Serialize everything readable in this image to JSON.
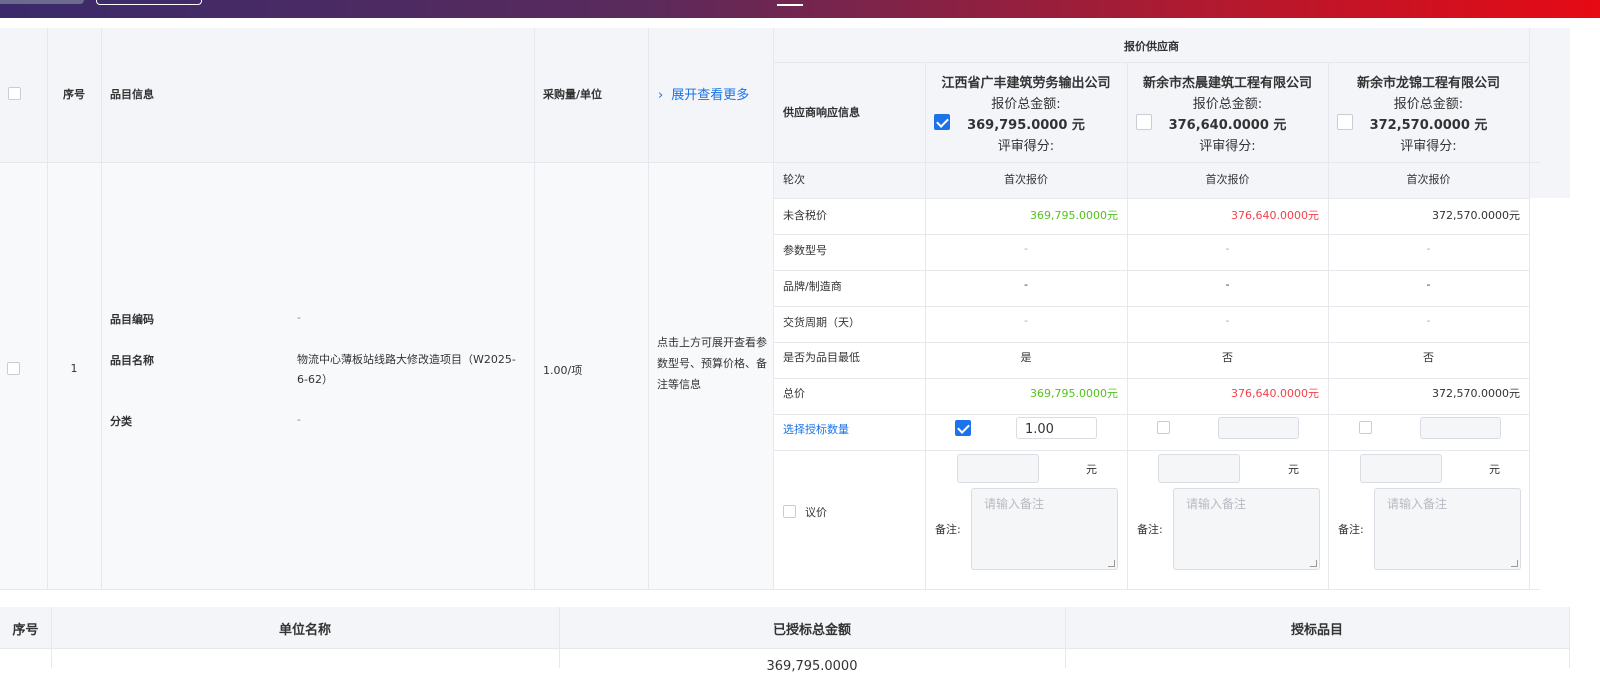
{
  "table": {
    "headers": {
      "seq": "序号",
      "item_info": "品目信息",
      "qty_unit": "采购量/单位",
      "expand_more": "展开查看更多",
      "quoted_suppliers": "报价供应商",
      "supplier_response": "供应商响应信息"
    },
    "suppliers": [
      {
        "name": "江西省广丰建筑劳务输出公司",
        "total_label": "报价总金额:",
        "total": "369,795.0000 元",
        "score_label": "评审得分:",
        "checked": true
      },
      {
        "name": "新余市杰晨建筑工程有限公司",
        "total_label": "报价总金额:",
        "total": "376,640.0000 元",
        "score_label": "评审得分:",
        "checked": false
      },
      {
        "name": "新余市龙锦工程有限公司",
        "total_label": "报价总金额:",
        "total": "372,570.0000 元",
        "score_label": "评审得分:",
        "checked": false
      }
    ],
    "row": {
      "seq": "1",
      "code_label": "品目编码",
      "code_value": "-",
      "name_label": "品目名称",
      "name_value": "物流中心薄板站线路大修改造项目（W2025-6-62）",
      "category_label": "分类",
      "category_value": "-",
      "qty": "1.00/项",
      "expand_hint": "点击上方可展开查看参数型号、预算价格、备注等信息"
    },
    "attributes": [
      {
        "label": "轮次",
        "values": [
          "首次报价",
          "首次报价",
          "首次报价"
        ]
      },
      {
        "label": "未含税价",
        "values": [
          "369,795.0000元",
          "376,640.0000元",
          "372,570.0000元"
        ]
      },
      {
        "label": "参数型号",
        "values": [
          "-",
          "-",
          "-"
        ]
      },
      {
        "label": "品牌/制造商",
        "values": [
          "-",
          "-",
          "-"
        ]
      },
      {
        "label": "交货周期（天）",
        "values": [
          "-",
          "-",
          "-"
        ]
      },
      {
        "label": "是否为品目最低",
        "values": [
          "是",
          "否",
          "否"
        ]
      },
      {
        "label": "总价",
        "values": [
          "369,795.0000元",
          "376,640.0000元",
          "372,570.0000元"
        ]
      }
    ],
    "award": {
      "label": "选择授标数量",
      "values": [
        "1.00",
        "",
        ""
      ],
      "checked": [
        true,
        false,
        false
      ]
    },
    "negotiate": {
      "label": "议价",
      "unit": "元",
      "remark_label": "备注:",
      "remark_placeholder": "请输入备注"
    }
  },
  "summary": {
    "headers": [
      "序号",
      "单位名称",
      "已授标总金额",
      "授标品目"
    ],
    "first_amount": "369,795.0000"
  },
  "colors": {
    "accent": "#1a73e8",
    "lowest": "#52c41a",
    "highest": "#f5404a",
    "header_bg": "#f3f5f9"
  }
}
